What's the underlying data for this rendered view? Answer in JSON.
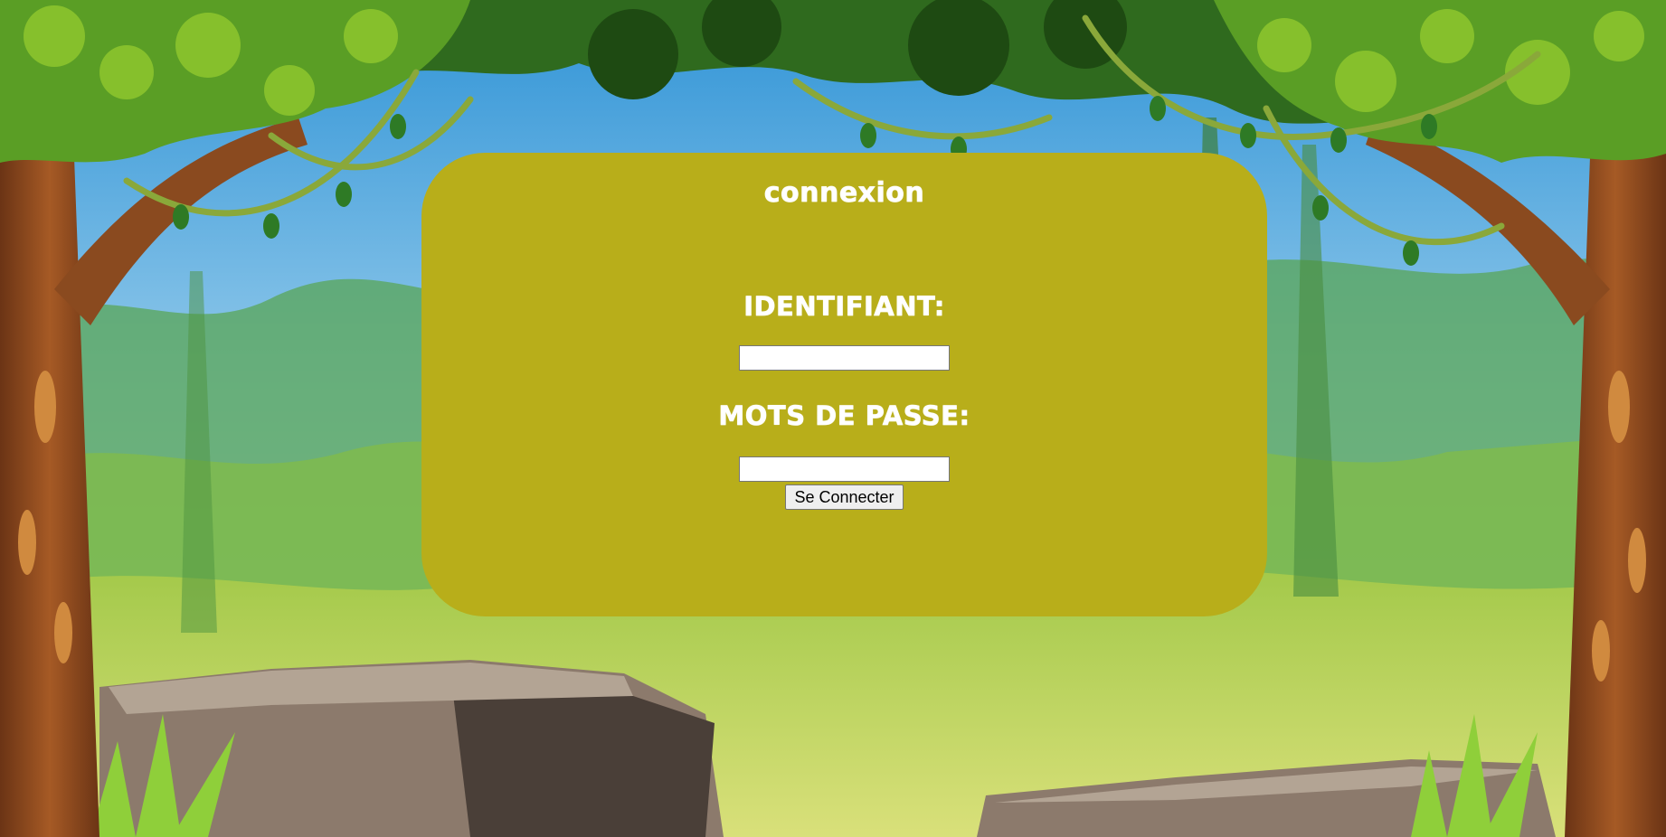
{
  "colors": {
    "card": "#b8ae1a",
    "label": "#ffffff",
    "sky_top": "#3a9bd8",
    "sky_bottom": "#d6eefa",
    "foliage_dark": "#2f6a1e",
    "foliage_light": "#7cba2a",
    "trunk": "#8a4a1f",
    "rock": "#8c7a6c"
  },
  "background": {
    "theme": "jungle-illustration"
  },
  "login": {
    "title": "connexion",
    "username_label": "Identifiant:",
    "username_value": "",
    "password_label": "Mots de passe:",
    "password_value": "",
    "submit_label": "Se Connecter"
  }
}
